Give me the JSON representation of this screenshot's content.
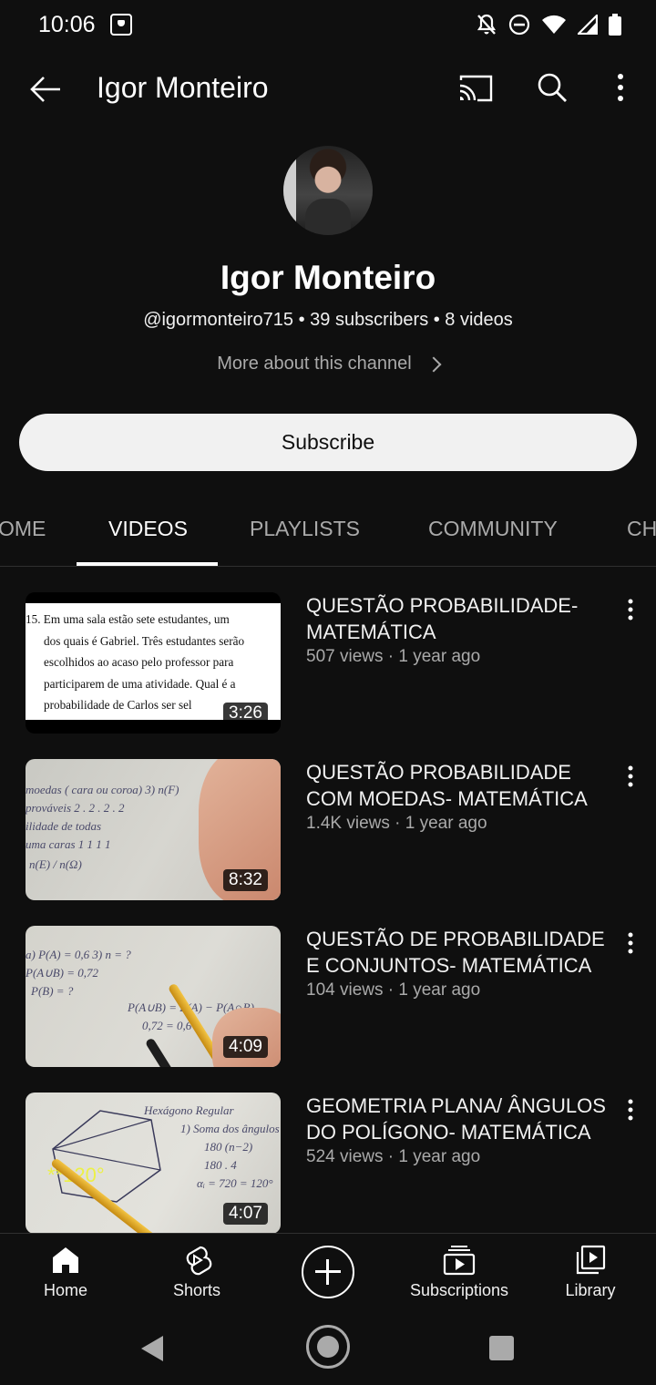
{
  "status_bar": {
    "time": "10:06",
    "icons": [
      "shield-icon",
      "notifications-off-icon",
      "do-not-disturb-icon",
      "wifi-icon",
      "signal-icon",
      "battery-icon"
    ]
  },
  "app_bar": {
    "title": "Igor Monteiro",
    "icons": [
      "back-arrow-icon",
      "cast-icon",
      "search-icon",
      "more-vert-icon"
    ]
  },
  "channel": {
    "name": "Igor Monteiro",
    "meta": "@igormonteiro715 • 39 subscribers • 8 videos",
    "more_about": "More about this channel",
    "subscribe_label": "Subscribe"
  },
  "tabs": [
    {
      "label": "HOME",
      "visible_text": "OME"
    },
    {
      "label": "VIDEOS",
      "active": true
    },
    {
      "label": "PLAYLISTS"
    },
    {
      "label": "COMMUNITY"
    },
    {
      "label": "CHANNELS",
      "visible_text": "CH"
    }
  ],
  "videos": [
    {
      "title": "QUESTÃO PROBABILIDADE- MATEMÁTICA",
      "meta": "507 views · 1 year ago",
      "duration": "3:26",
      "thumb_text": [
        "15.   Em uma sala estão sete estudantes, um",
        "dos quais é Gabriel. Três estudantes serão",
        "escolhidos ao acaso pelo professor para",
        "participarem de uma atividade. Qual é a",
        "probabilidade de Carlos ser sel"
      ]
    },
    {
      "title": "QUESTÃO PROBABILIDADE COM MOEDAS- MATEMÁTICA",
      "meta": "1.4K views · 1 year ago",
      "duration": "8:32"
    },
    {
      "title": "QUESTÃO DE PROBABILIDADE E CONJUNTOS- MATEMÁTICA",
      "meta": "104 views · 1 year ago",
      "duration": "4:09"
    },
    {
      "title": "GEOMETRIA PLANA/ ÂNGULOS DO POLÍGONO- MATEMÁTICA",
      "meta": "524 views · 1 year ago",
      "duration": "4:07",
      "thumb_overlay": "**120°"
    }
  ],
  "bottom_nav": {
    "home": "Home",
    "shorts": "Shorts",
    "subscriptions": "Subscriptions",
    "library": "Library"
  }
}
